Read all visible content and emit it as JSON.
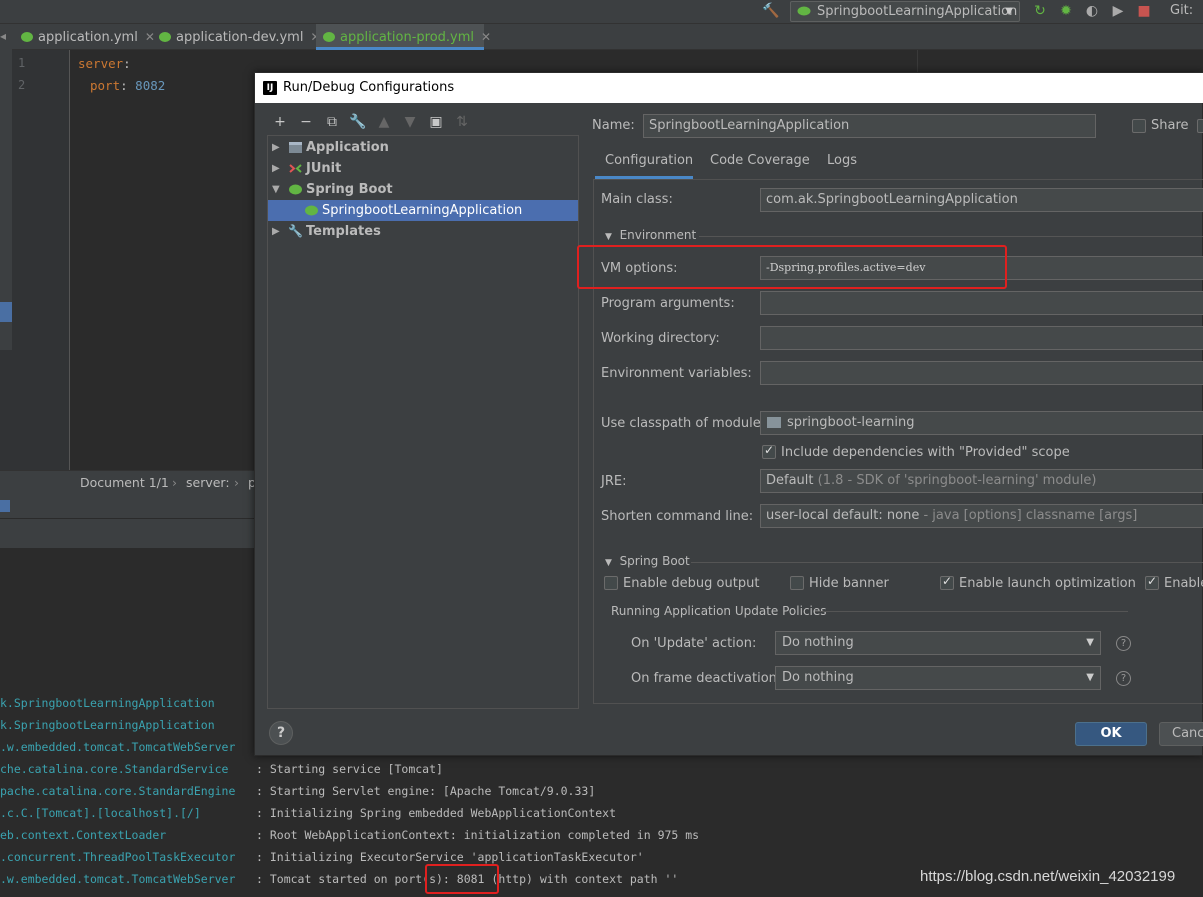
{
  "toolbar": {
    "run_config": "SpringbootLearningApplication",
    "git_label": "Git:"
  },
  "tabs": [
    {
      "label": "application.yml"
    },
    {
      "label": "application-dev.yml"
    },
    {
      "label": "application-prod.yml"
    }
  ],
  "editor": {
    "line_numbers": [
      "1",
      "2"
    ],
    "line1_key": "server",
    "line2_key": "port",
    "line2_value": "8082",
    "breadcrumb_doc": "Document 1/1",
    "breadcrumb_sep": "›",
    "breadcrumb_server": "server:",
    "breadcrumb_more": "p"
  },
  "console": {
    "logs": [
      {
        "logger": "k.SpringbootLearningApplication",
        "msg": ""
      },
      {
        "logger": "k.SpringbootLearningApplication",
        "msg": ""
      },
      {
        "logger": ".w.embedded.tomcat.TomcatWebServer",
        "msg": ""
      },
      {
        "logger": "che.catalina.core.StandardService",
        "msg": ": Starting service [Tomcat]"
      },
      {
        "logger": "pache.catalina.core.StandardEngine",
        "msg": ": Starting Servlet engine: [Apache Tomcat/9.0.33]"
      },
      {
        "logger": ".c.C.[Tomcat].[localhost].[/]",
        "msg": ": Initializing Spring embedded WebApplicationContext"
      },
      {
        "logger": "eb.context.ContextLoader",
        "msg": ": Root WebApplicationContext: initialization completed in 975 ms"
      },
      {
        "logger": ".concurrent.ThreadPoolTaskExecutor",
        "msg": ": Initializing ExecutorService 'applicationTaskExecutor'"
      },
      {
        "logger": ".w.embedded.tomcat.TomcatWebServer",
        "msg": ": Tomcat started on port(s): 8081 (http) with context path ''"
      }
    ],
    "watermark": "https://blog.csdn.net/weixin_42032199"
  },
  "dialog": {
    "title": "Run/Debug Configurations",
    "tree": [
      {
        "label": "Application"
      },
      {
        "label": "JUnit"
      },
      {
        "label": "Spring Boot"
      },
      {
        "label": "SpringbootLearningApplication"
      },
      {
        "label": "Templates"
      }
    ],
    "name_label": "Name:",
    "name_value": "SpringbootLearningApplication",
    "share_label": "Share",
    "config_tabs": [
      "Configuration",
      "Code Coverage",
      "Logs"
    ],
    "main_class_label": "Main class:",
    "main_class_value": "com.ak.SpringbootLearningApplication",
    "environment_header": "Environment",
    "vm_options_label": "VM options:",
    "vm_options_value": "-Dspring.profiles.active=dev",
    "program_args_label": "Program arguments:",
    "working_dir_label": "Working directory:",
    "env_vars_label": "Environment variables:",
    "classpath_label": "Use classpath of module:",
    "classpath_value": "springboot-learning",
    "include_deps_label": "Include dependencies with \"Provided\" scope",
    "include_deps_checked": true,
    "jre_label": "JRE:",
    "jre_value_main": "Default",
    "jre_value_detail": "(1.8 - SDK of 'springboot-learning' module)",
    "shorten_label": "Shorten command line:",
    "shorten_value_main": "user-local default: none",
    "shorten_value_detail": "- java [options] classname [args]",
    "spring_boot_header": "Spring Boot",
    "enable_debug_label": "Enable debug output",
    "enable_debug_checked": false,
    "hide_banner_label": "Hide banner",
    "hide_banner_checked": false,
    "launch_opt_label": "Enable launch optimization",
    "launch_opt_checked": true,
    "enable_jmx_label": "Enable",
    "enable_jmx_checked": true,
    "update_policies_header": "Running Application Update Policies",
    "on_update_label": "On 'Update' action:",
    "on_update_value": "Do nothing",
    "on_frame_label": "On frame deactivation:",
    "on_frame_value": "Do nothing",
    "help_label": "?",
    "ok_label": "OK",
    "cancel_label": "Canc"
  },
  "colors": {
    "accent_blue": "#4a88c7",
    "selection": "#4b6eaf",
    "highlight_red": "#e0201f",
    "spring_green": "#62b543"
  }
}
